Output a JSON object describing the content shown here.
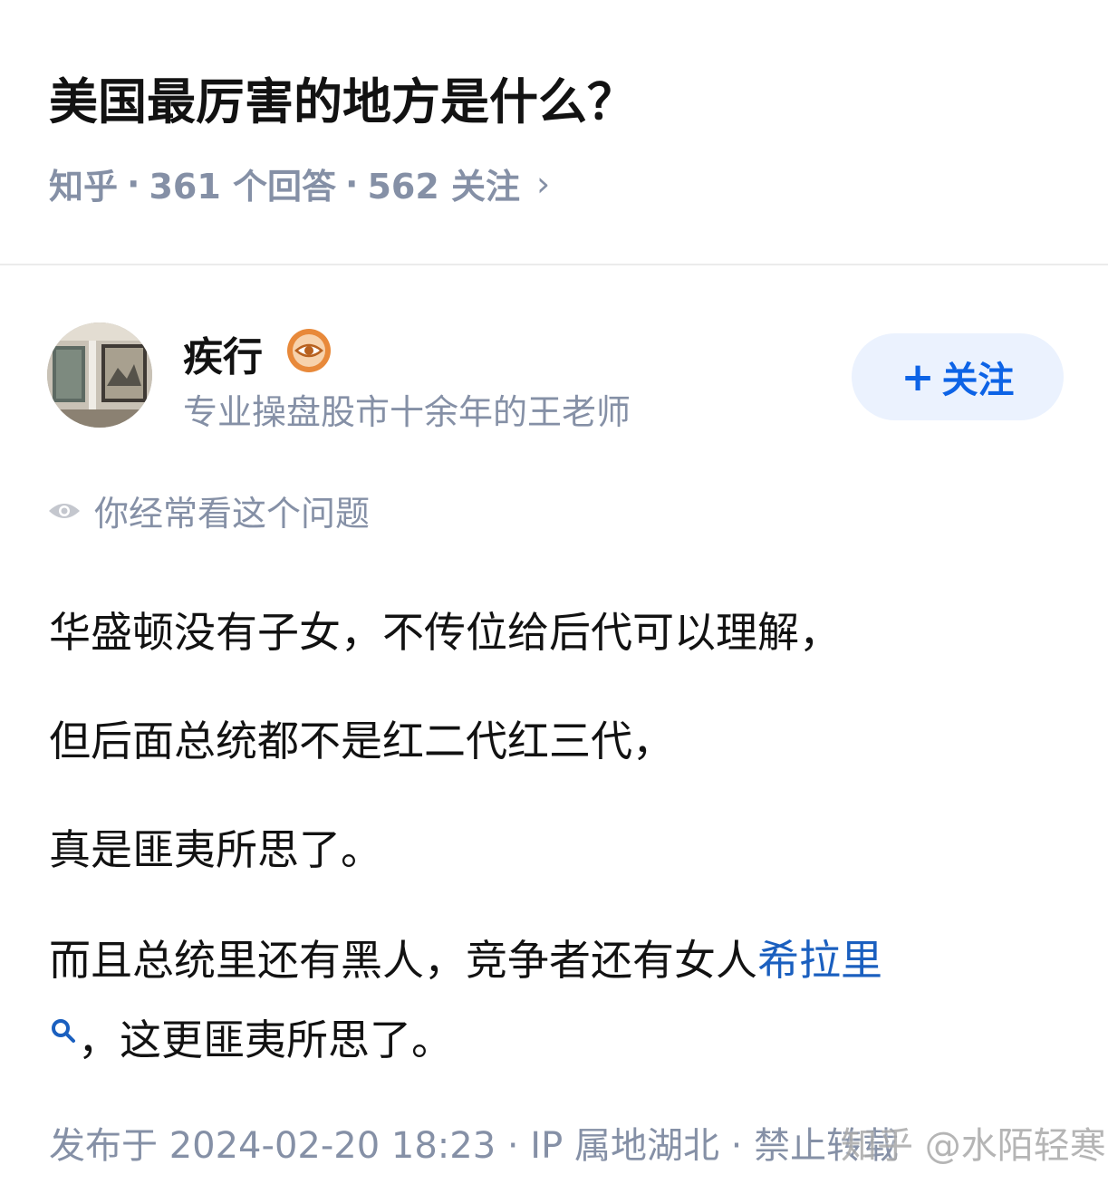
{
  "question": {
    "title": "美国最厉害的地方是什么？",
    "source": "知乎",
    "answers": "361 个回答",
    "follows": "562 关注",
    "dot": "·",
    "chevron": "›"
  },
  "author": {
    "name": "疾行",
    "badge_icon": "eye-badge-icon",
    "bio": "专业操盘股市十余年的王老师",
    "follow_plus": "+",
    "follow_label": "关注"
  },
  "hint": {
    "icon": "eye-icon",
    "text": "你经常看这个问题"
  },
  "answer": {
    "p1": "华盛顿没有子女，不传位给后代可以理解，",
    "p2": "但后面总统都不是红二代红三代，",
    "p3": "真是匪夷所思了。",
    "p4_prefix": "而且总统里还有黑人，竞争者还有女人",
    "p4_link": "希拉里",
    "p5_text": "，这更匪夷所思了。",
    "search_icon": "search-icon"
  },
  "footer": {
    "meta": "发布于 2024-02-20 18:23 · IP 属地湖北 · 禁止转载"
  },
  "watermark": {
    "text": "知乎 @水陌轻寒"
  },
  "colors": {
    "meta_gray": "#8590a6",
    "link_blue": "#1a5fbf",
    "follow_bg": "#ebf2fe",
    "follow_text": "#0d63e6",
    "badge_orange": "#e8893a"
  }
}
